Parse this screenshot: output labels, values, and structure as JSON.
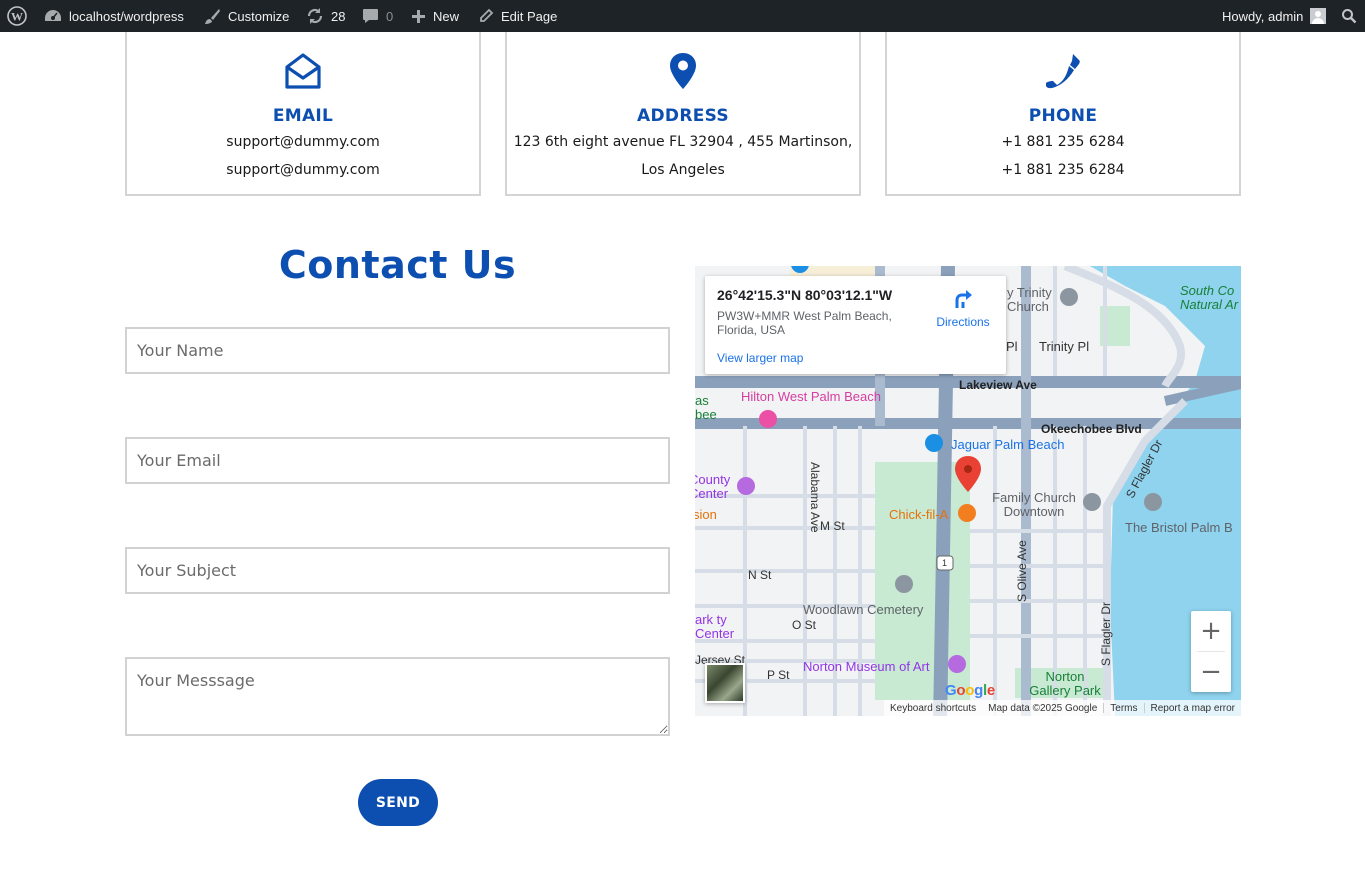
{
  "adminbar": {
    "site_name": "localhost/wordpress",
    "customize": "Customize",
    "updates_count": "28",
    "comments_count": "0",
    "new_label": "New",
    "edit_label": "Edit Page",
    "howdy": "Howdy, admin",
    "icons": [
      "wordpress-logo-icon",
      "dashboard-icon",
      "brush-icon",
      "updates-icon",
      "comment-icon",
      "plus-icon",
      "pencil-icon",
      "avatar",
      "search-icon"
    ]
  },
  "cards": [
    {
      "icon": "envelope-open-icon",
      "title": "EMAIL",
      "line1": "support@dummy.com",
      "line2": "support@dummy.com"
    },
    {
      "icon": "map-pin-icon",
      "title": "ADDRESS",
      "line1": "123 6th eight avenue FL 32904 , 455 Martinson,",
      "line2": "Los Angeles"
    },
    {
      "icon": "phone-icon",
      "title": "PHONE",
      "line1": "+1 881 235 6284",
      "line2": "+1 881 235 6284"
    }
  ],
  "contact": {
    "title": "Contact Us",
    "name_placeholder": "Your Name",
    "email_placeholder": "Your Email",
    "subject_placeholder": "Your Subject",
    "message_placeholder": "Your Messsage",
    "send_label": "SEND"
  },
  "map": {
    "coords": "26°42'15.3\"N 80°03'12.1\"W",
    "address": "PW3W+MMR West Palm Beach, Florida, USA",
    "directions": "Directions",
    "larger_map": "View larger map",
    "zoom_in": "+",
    "zoom_out": "−",
    "logo": "Google",
    "attribution": {
      "shortcuts": "Keyboard shortcuts",
      "data": "Map data ©2025 Google",
      "terms": "Terms",
      "report": "Report a map error"
    },
    "labels": {
      "hilton": "Hilton West Palm Beach",
      "jaguar": "Jaguar Palm Beach",
      "chick": "Chick-fil-A",
      "family_church": "Family Church Downtown",
      "bristol": "The Bristol Palm B",
      "woodlawn": "Woodlawn Cemetery",
      "norton_museum": "Norton Museum of Art",
      "norton_park": "Norton Gallery Park",
      "south_co": "South Co Natural Ar",
      "trinity_church": "y Trinity Church",
      "trinity_pl": "Trinity Pl",
      "pl": "Pl",
      "lakeview": "Lakeview Ave",
      "okeechobee": "Okeechobee Blvd",
      "alabama": "Alabama Ave",
      "m_st": "M St",
      "n_st": "N St",
      "o_st": "O St",
      "p_st": "P St",
      "s_olive": "S Olive Ave",
      "s_flagler": "S Flagler Dr",
      "s_flagler2": "S Flagler Dr",
      "county": "County Center",
      "sion": "sion",
      "as": "as",
      "bee": "bee",
      "ark": "ark ty Center",
      "jersey": "Jersey St",
      "route": "1"
    }
  }
}
